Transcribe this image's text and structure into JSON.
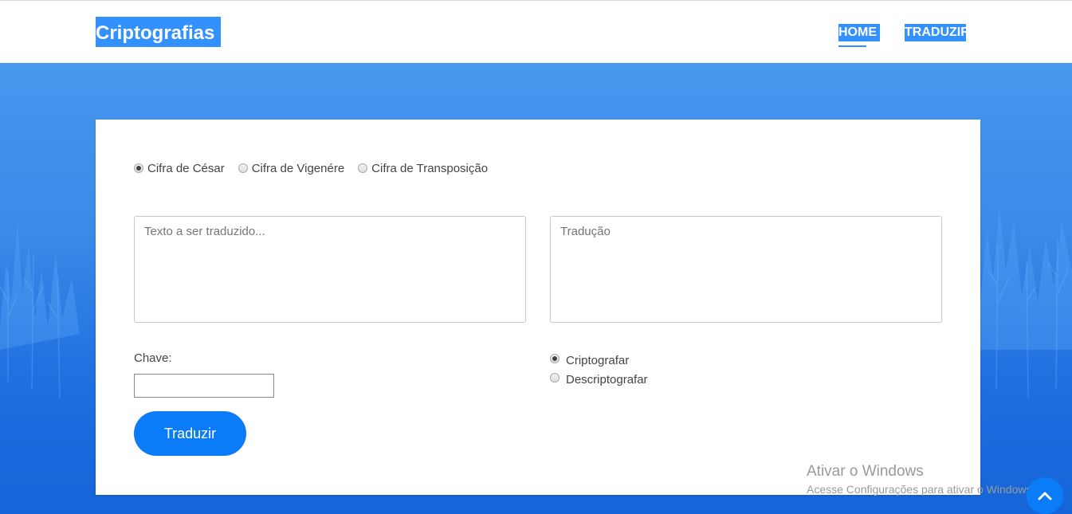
{
  "navbar": {
    "brand": "Criptografias",
    "links": [
      {
        "label": "HOME",
        "active": true
      },
      {
        "label": "TRADUZIR",
        "active": false
      }
    ]
  },
  "cipher_options": [
    {
      "label": "Cifra de César",
      "checked": true
    },
    {
      "label": "Cifra de Vigenére",
      "checked": false
    },
    {
      "label": "Cifra de Transposição",
      "checked": false
    }
  ],
  "input_text": {
    "placeholder": "Texto a ser traduzido...",
    "value": ""
  },
  "output_text": {
    "placeholder": "Tradução",
    "value": ""
  },
  "key": {
    "label": "Chave:",
    "value": ""
  },
  "mode_options": [
    {
      "label": "Criptografar",
      "checked": true
    },
    {
      "label": "Descriptografar",
      "checked": false
    }
  ],
  "translate_button": "Traduzir",
  "watermark": {
    "title": "Ativar o Windows",
    "subtitle": "Acesse Configurações para ativar o Windows."
  },
  "colors": {
    "accent": "#0a7cf8",
    "brand_bg": "#3390ff",
    "background_top": "#4d9df2",
    "background_bottom": "#1565d8"
  },
  "icons": {
    "scroll_top": "chevron-up-icon"
  }
}
